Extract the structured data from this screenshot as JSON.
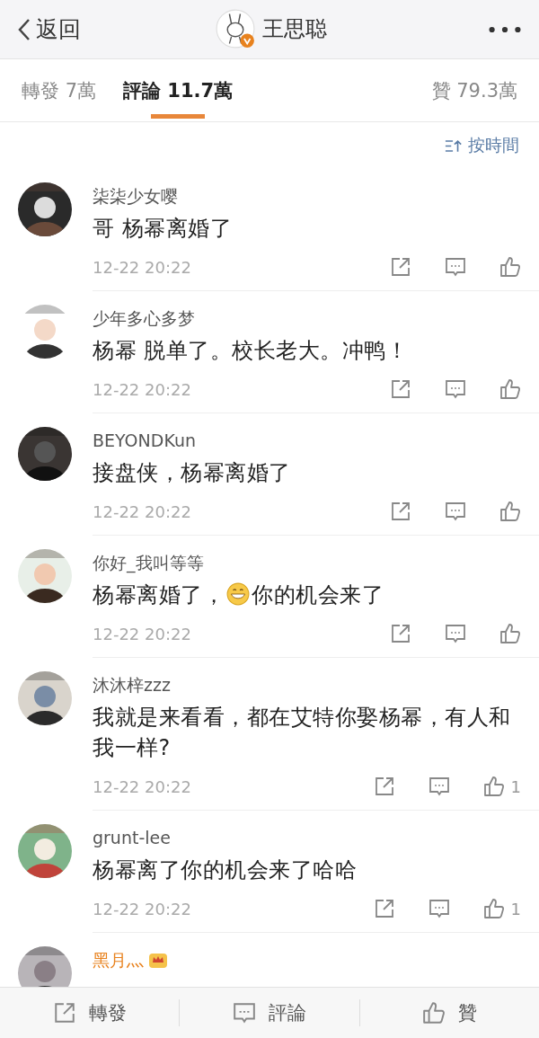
{
  "header": {
    "back": {
      "label": "返回"
    },
    "title": "王思聪",
    "verified": true
  },
  "tabs": [
    {
      "label": "轉發 7萬",
      "selected": false
    },
    {
      "label": "評論 11.7萬",
      "selected": true
    },
    {
      "label": "贊 79.3萬",
      "selected": false
    }
  ],
  "sort": {
    "label": "按時間"
  },
  "comments": [
    {
      "user": "柒柒少女嘤",
      "vip": false,
      "content": [
        {
          "kind": "text",
          "text": "哥 杨幂离婚了"
        }
      ],
      "time": "12-22 20:22"
    },
    {
      "user": "少年多心多梦",
      "vip": false,
      "content": [
        {
          "kind": "text",
          "text": "杨幂 脱单了。校长老大。冲鸭！"
        }
      ],
      "time": "12-22 20:22"
    },
    {
      "user": "BEYONDKun",
      "vip": false,
      "content": [
        {
          "kind": "text",
          "text": "接盘侠，杨幂离婚了"
        }
      ],
      "time": "12-22 20:22"
    },
    {
      "user": "你好_我叫等等",
      "vip": false,
      "content": [
        {
          "kind": "text",
          "text": "杨幂离婚了，"
        },
        {
          "kind": "emoji"
        },
        {
          "kind": "text",
          "text": "你的机会来了"
        }
      ],
      "time": "12-22 20:22"
    },
    {
      "user": "沐沐梓zzz",
      "vip": false,
      "content": [
        {
          "kind": "text",
          "text": "我就是来看看，都在艾特你娶杨幂，有人和我一样?"
        }
      ],
      "time": "12-22 20:22",
      "likes": "1"
    },
    {
      "user": "grunt-lee",
      "vip": false,
      "content": [
        {
          "kind": "text",
          "text": "杨幂离了你的机会来了哈哈"
        }
      ],
      "time": "12-22 20:22",
      "likes": "1"
    },
    {
      "user": "黑月灬",
      "vip": true
    }
  ],
  "bottom_bar": [
    {
      "kind": "share",
      "label": "轉發"
    },
    {
      "kind": "comment",
      "label": "評論"
    },
    {
      "kind": "like",
      "label": "贊"
    }
  ]
}
